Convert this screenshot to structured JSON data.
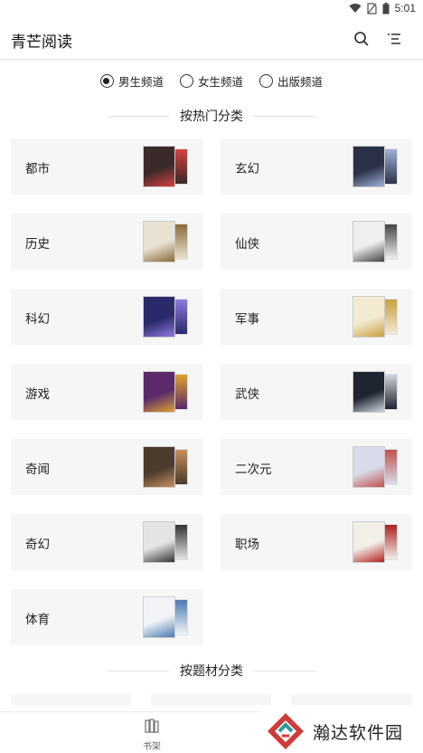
{
  "status_bar": {
    "time": "5:01"
  },
  "app_bar": {
    "title": "青芒阅读",
    "search_icon": "search-icon",
    "menu_icon": "menu-icon"
  },
  "channels": [
    {
      "label": "男生频道",
      "checked": true
    },
    {
      "label": "女生频道",
      "checked": false
    },
    {
      "label": "出版频道",
      "checked": false
    }
  ],
  "hot_section": {
    "title": "按热门分类"
  },
  "categories": [
    {
      "label": "都市",
      "cover_color": "#3a2a2a",
      "accent": "#d64040"
    },
    {
      "label": "玄幻",
      "cover_color": "#2b3248",
      "accent": "#9fb0d8"
    },
    {
      "label": "历史",
      "cover_color": "#e9e2d2",
      "accent": "#8a6a3a"
    },
    {
      "label": "仙侠",
      "cover_color": "#f0efee",
      "accent": "#444444"
    },
    {
      "label": "科幻",
      "cover_color": "#2a2a6a",
      "accent": "#8f7ae0"
    },
    {
      "label": "军事",
      "cover_color": "#f3ead2",
      "accent": "#c9a040"
    },
    {
      "label": "游戏",
      "cover_color": "#5a2a6a",
      "accent": "#e0a030"
    },
    {
      "label": "武侠",
      "cover_color": "#1e2430",
      "accent": "#cfd6e0"
    },
    {
      "label": "奇闻",
      "cover_color": "#4a3b2c",
      "accent": "#c89060"
    },
    {
      "label": "二次元",
      "cover_color": "#d8dcea",
      "accent": "#c05050"
    },
    {
      "label": "奇幻",
      "cover_color": "#e4e4e4",
      "accent": "#333333"
    },
    {
      "label": "职场",
      "cover_color": "#f2efe9",
      "accent": "#b02020"
    },
    {
      "label": "体育",
      "cover_color": "#f2f4f7",
      "accent": "#4a7ab0"
    }
  ],
  "subject_section": {
    "title": "按题材分类"
  },
  "bottom_nav": {
    "shelf_label": "书架",
    "shelf_icon": "bookshelf-icon"
  },
  "watermark": {
    "text": "瀚达软件园",
    "logo_color": "#d03a3a",
    "logo_accent": "#2a9a9a"
  }
}
